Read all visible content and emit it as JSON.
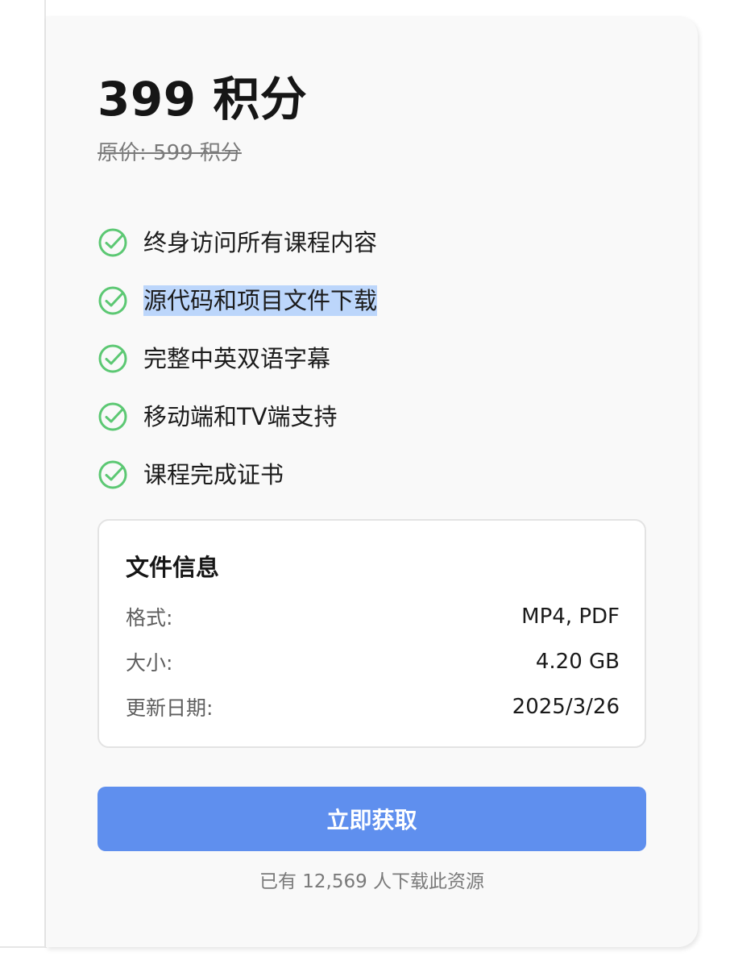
{
  "pricing": {
    "price": "399 积分",
    "original_price": "原价: 599 积分"
  },
  "features": [
    {
      "label": "终身访问所有课程内容",
      "icon": "check-circle-icon",
      "selected": false
    },
    {
      "label": "源代码和项目文件下载",
      "icon": "check-circle-icon",
      "selected": true
    },
    {
      "label": "完整中英双语字幕",
      "icon": "check-circle-icon",
      "selected": false
    },
    {
      "label": "移动端和TV端支持",
      "icon": "check-circle-icon",
      "selected": false
    },
    {
      "label": "课程完成证书",
      "icon": "check-circle-icon",
      "selected": false
    }
  ],
  "file_info": {
    "title": "文件信息",
    "rows": [
      {
        "key": "格式:",
        "value": "MP4, PDF"
      },
      {
        "key": "大小:",
        "value": "4.20 GB"
      },
      {
        "key": "更新日期:",
        "value": "2025/3/26"
      }
    ]
  },
  "cta": {
    "label": "立即获取"
  },
  "download_count_text": "已有 12,569 人下载此资源",
  "colors": {
    "accent": "#5f8fee",
    "check": "#5cc873",
    "selection": "#bcd6fb",
    "card_bg": "#f9f9f9"
  }
}
